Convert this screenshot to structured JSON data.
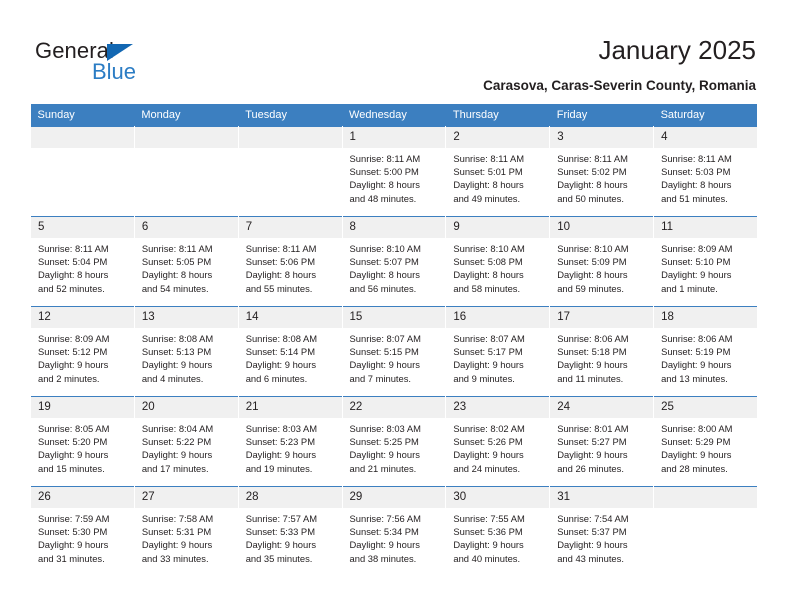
{
  "logo": {
    "primary_text": "General",
    "secondary_text": "Blue",
    "primary_color": "#231f20",
    "secondary_color": "#2b7cc4",
    "triangle_color": "#1267b2"
  },
  "header": {
    "title": "January 2025",
    "subtitle": "Carasova, Caras-Severin County, Romania"
  },
  "theme": {
    "header_row_bg": "#3c7fc0",
    "header_row_text": "#ffffff",
    "daynum_bg": "#f0f0f0",
    "cell_bg": "#ffffff",
    "text": "#231f20"
  },
  "weekday_headers": [
    "Sunday",
    "Monday",
    "Tuesday",
    "Wednesday",
    "Thursday",
    "Friday",
    "Saturday"
  ],
  "weeks": [
    [
      {
        "day": "",
        "empty": true,
        "sunrise": "",
        "sunset": "",
        "daylight_line1": "",
        "daylight_line2": ""
      },
      {
        "day": "",
        "empty": true,
        "sunrise": "",
        "sunset": "",
        "daylight_line1": "",
        "daylight_line2": ""
      },
      {
        "day": "",
        "empty": true,
        "sunrise": "",
        "sunset": "",
        "daylight_line1": "",
        "daylight_line2": ""
      },
      {
        "day": "1",
        "empty": false,
        "sunrise": "Sunrise: 8:11 AM",
        "sunset": "Sunset: 5:00 PM",
        "daylight_line1": "Daylight: 8 hours",
        "daylight_line2": "and 48 minutes."
      },
      {
        "day": "2",
        "empty": false,
        "sunrise": "Sunrise: 8:11 AM",
        "sunset": "Sunset: 5:01 PM",
        "daylight_line1": "Daylight: 8 hours",
        "daylight_line2": "and 49 minutes."
      },
      {
        "day": "3",
        "empty": false,
        "sunrise": "Sunrise: 8:11 AM",
        "sunset": "Sunset: 5:02 PM",
        "daylight_line1": "Daylight: 8 hours",
        "daylight_line2": "and 50 minutes."
      },
      {
        "day": "4",
        "empty": false,
        "sunrise": "Sunrise: 8:11 AM",
        "sunset": "Sunset: 5:03 PM",
        "daylight_line1": "Daylight: 8 hours",
        "daylight_line2": "and 51 minutes."
      }
    ],
    [
      {
        "day": "5",
        "empty": false,
        "sunrise": "Sunrise: 8:11 AM",
        "sunset": "Sunset: 5:04 PM",
        "daylight_line1": "Daylight: 8 hours",
        "daylight_line2": "and 52 minutes."
      },
      {
        "day": "6",
        "empty": false,
        "sunrise": "Sunrise: 8:11 AM",
        "sunset": "Sunset: 5:05 PM",
        "daylight_line1": "Daylight: 8 hours",
        "daylight_line2": "and 54 minutes."
      },
      {
        "day": "7",
        "empty": false,
        "sunrise": "Sunrise: 8:11 AM",
        "sunset": "Sunset: 5:06 PM",
        "daylight_line1": "Daylight: 8 hours",
        "daylight_line2": "and 55 minutes."
      },
      {
        "day": "8",
        "empty": false,
        "sunrise": "Sunrise: 8:10 AM",
        "sunset": "Sunset: 5:07 PM",
        "daylight_line1": "Daylight: 8 hours",
        "daylight_line2": "and 56 minutes."
      },
      {
        "day": "9",
        "empty": false,
        "sunrise": "Sunrise: 8:10 AM",
        "sunset": "Sunset: 5:08 PM",
        "daylight_line1": "Daylight: 8 hours",
        "daylight_line2": "and 58 minutes."
      },
      {
        "day": "10",
        "empty": false,
        "sunrise": "Sunrise: 8:10 AM",
        "sunset": "Sunset: 5:09 PM",
        "daylight_line1": "Daylight: 8 hours",
        "daylight_line2": "and 59 minutes."
      },
      {
        "day": "11",
        "empty": false,
        "sunrise": "Sunrise: 8:09 AM",
        "sunset": "Sunset: 5:10 PM",
        "daylight_line1": "Daylight: 9 hours",
        "daylight_line2": "and 1 minute."
      }
    ],
    [
      {
        "day": "12",
        "empty": false,
        "sunrise": "Sunrise: 8:09 AM",
        "sunset": "Sunset: 5:12 PM",
        "daylight_line1": "Daylight: 9 hours",
        "daylight_line2": "and 2 minutes."
      },
      {
        "day": "13",
        "empty": false,
        "sunrise": "Sunrise: 8:08 AM",
        "sunset": "Sunset: 5:13 PM",
        "daylight_line1": "Daylight: 9 hours",
        "daylight_line2": "and 4 minutes."
      },
      {
        "day": "14",
        "empty": false,
        "sunrise": "Sunrise: 8:08 AM",
        "sunset": "Sunset: 5:14 PM",
        "daylight_line1": "Daylight: 9 hours",
        "daylight_line2": "and 6 minutes."
      },
      {
        "day": "15",
        "empty": false,
        "sunrise": "Sunrise: 8:07 AM",
        "sunset": "Sunset: 5:15 PM",
        "daylight_line1": "Daylight: 9 hours",
        "daylight_line2": "and 7 minutes."
      },
      {
        "day": "16",
        "empty": false,
        "sunrise": "Sunrise: 8:07 AM",
        "sunset": "Sunset: 5:17 PM",
        "daylight_line1": "Daylight: 9 hours",
        "daylight_line2": "and 9 minutes."
      },
      {
        "day": "17",
        "empty": false,
        "sunrise": "Sunrise: 8:06 AM",
        "sunset": "Sunset: 5:18 PM",
        "daylight_line1": "Daylight: 9 hours",
        "daylight_line2": "and 11 minutes."
      },
      {
        "day": "18",
        "empty": false,
        "sunrise": "Sunrise: 8:06 AM",
        "sunset": "Sunset: 5:19 PM",
        "daylight_line1": "Daylight: 9 hours",
        "daylight_line2": "and 13 minutes."
      }
    ],
    [
      {
        "day": "19",
        "empty": false,
        "sunrise": "Sunrise: 8:05 AM",
        "sunset": "Sunset: 5:20 PM",
        "daylight_line1": "Daylight: 9 hours",
        "daylight_line2": "and 15 minutes."
      },
      {
        "day": "20",
        "empty": false,
        "sunrise": "Sunrise: 8:04 AM",
        "sunset": "Sunset: 5:22 PM",
        "daylight_line1": "Daylight: 9 hours",
        "daylight_line2": "and 17 minutes."
      },
      {
        "day": "21",
        "empty": false,
        "sunrise": "Sunrise: 8:03 AM",
        "sunset": "Sunset: 5:23 PM",
        "daylight_line1": "Daylight: 9 hours",
        "daylight_line2": "and 19 minutes."
      },
      {
        "day": "22",
        "empty": false,
        "sunrise": "Sunrise: 8:03 AM",
        "sunset": "Sunset: 5:25 PM",
        "daylight_line1": "Daylight: 9 hours",
        "daylight_line2": "and 21 minutes."
      },
      {
        "day": "23",
        "empty": false,
        "sunrise": "Sunrise: 8:02 AM",
        "sunset": "Sunset: 5:26 PM",
        "daylight_line1": "Daylight: 9 hours",
        "daylight_line2": "and 24 minutes."
      },
      {
        "day": "24",
        "empty": false,
        "sunrise": "Sunrise: 8:01 AM",
        "sunset": "Sunset: 5:27 PM",
        "daylight_line1": "Daylight: 9 hours",
        "daylight_line2": "and 26 minutes."
      },
      {
        "day": "25",
        "empty": false,
        "sunrise": "Sunrise: 8:00 AM",
        "sunset": "Sunset: 5:29 PM",
        "daylight_line1": "Daylight: 9 hours",
        "daylight_line2": "and 28 minutes."
      }
    ],
    [
      {
        "day": "26",
        "empty": false,
        "sunrise": "Sunrise: 7:59 AM",
        "sunset": "Sunset: 5:30 PM",
        "daylight_line1": "Daylight: 9 hours",
        "daylight_line2": "and 31 minutes."
      },
      {
        "day": "27",
        "empty": false,
        "sunrise": "Sunrise: 7:58 AM",
        "sunset": "Sunset: 5:31 PM",
        "daylight_line1": "Daylight: 9 hours",
        "daylight_line2": "and 33 minutes."
      },
      {
        "day": "28",
        "empty": false,
        "sunrise": "Sunrise: 7:57 AM",
        "sunset": "Sunset: 5:33 PM",
        "daylight_line1": "Daylight: 9 hours",
        "daylight_line2": "and 35 minutes."
      },
      {
        "day": "29",
        "empty": false,
        "sunrise": "Sunrise: 7:56 AM",
        "sunset": "Sunset: 5:34 PM",
        "daylight_line1": "Daylight: 9 hours",
        "daylight_line2": "and 38 minutes."
      },
      {
        "day": "30",
        "empty": false,
        "sunrise": "Sunrise: 7:55 AM",
        "sunset": "Sunset: 5:36 PM",
        "daylight_line1": "Daylight: 9 hours",
        "daylight_line2": "and 40 minutes."
      },
      {
        "day": "31",
        "empty": false,
        "sunrise": "Sunrise: 7:54 AM",
        "sunset": "Sunset: 5:37 PM",
        "daylight_line1": "Daylight: 9 hours",
        "daylight_line2": "and 43 minutes."
      },
      {
        "day": "",
        "empty": true,
        "sunrise": "",
        "sunset": "",
        "daylight_line1": "",
        "daylight_line2": ""
      }
    ]
  ]
}
